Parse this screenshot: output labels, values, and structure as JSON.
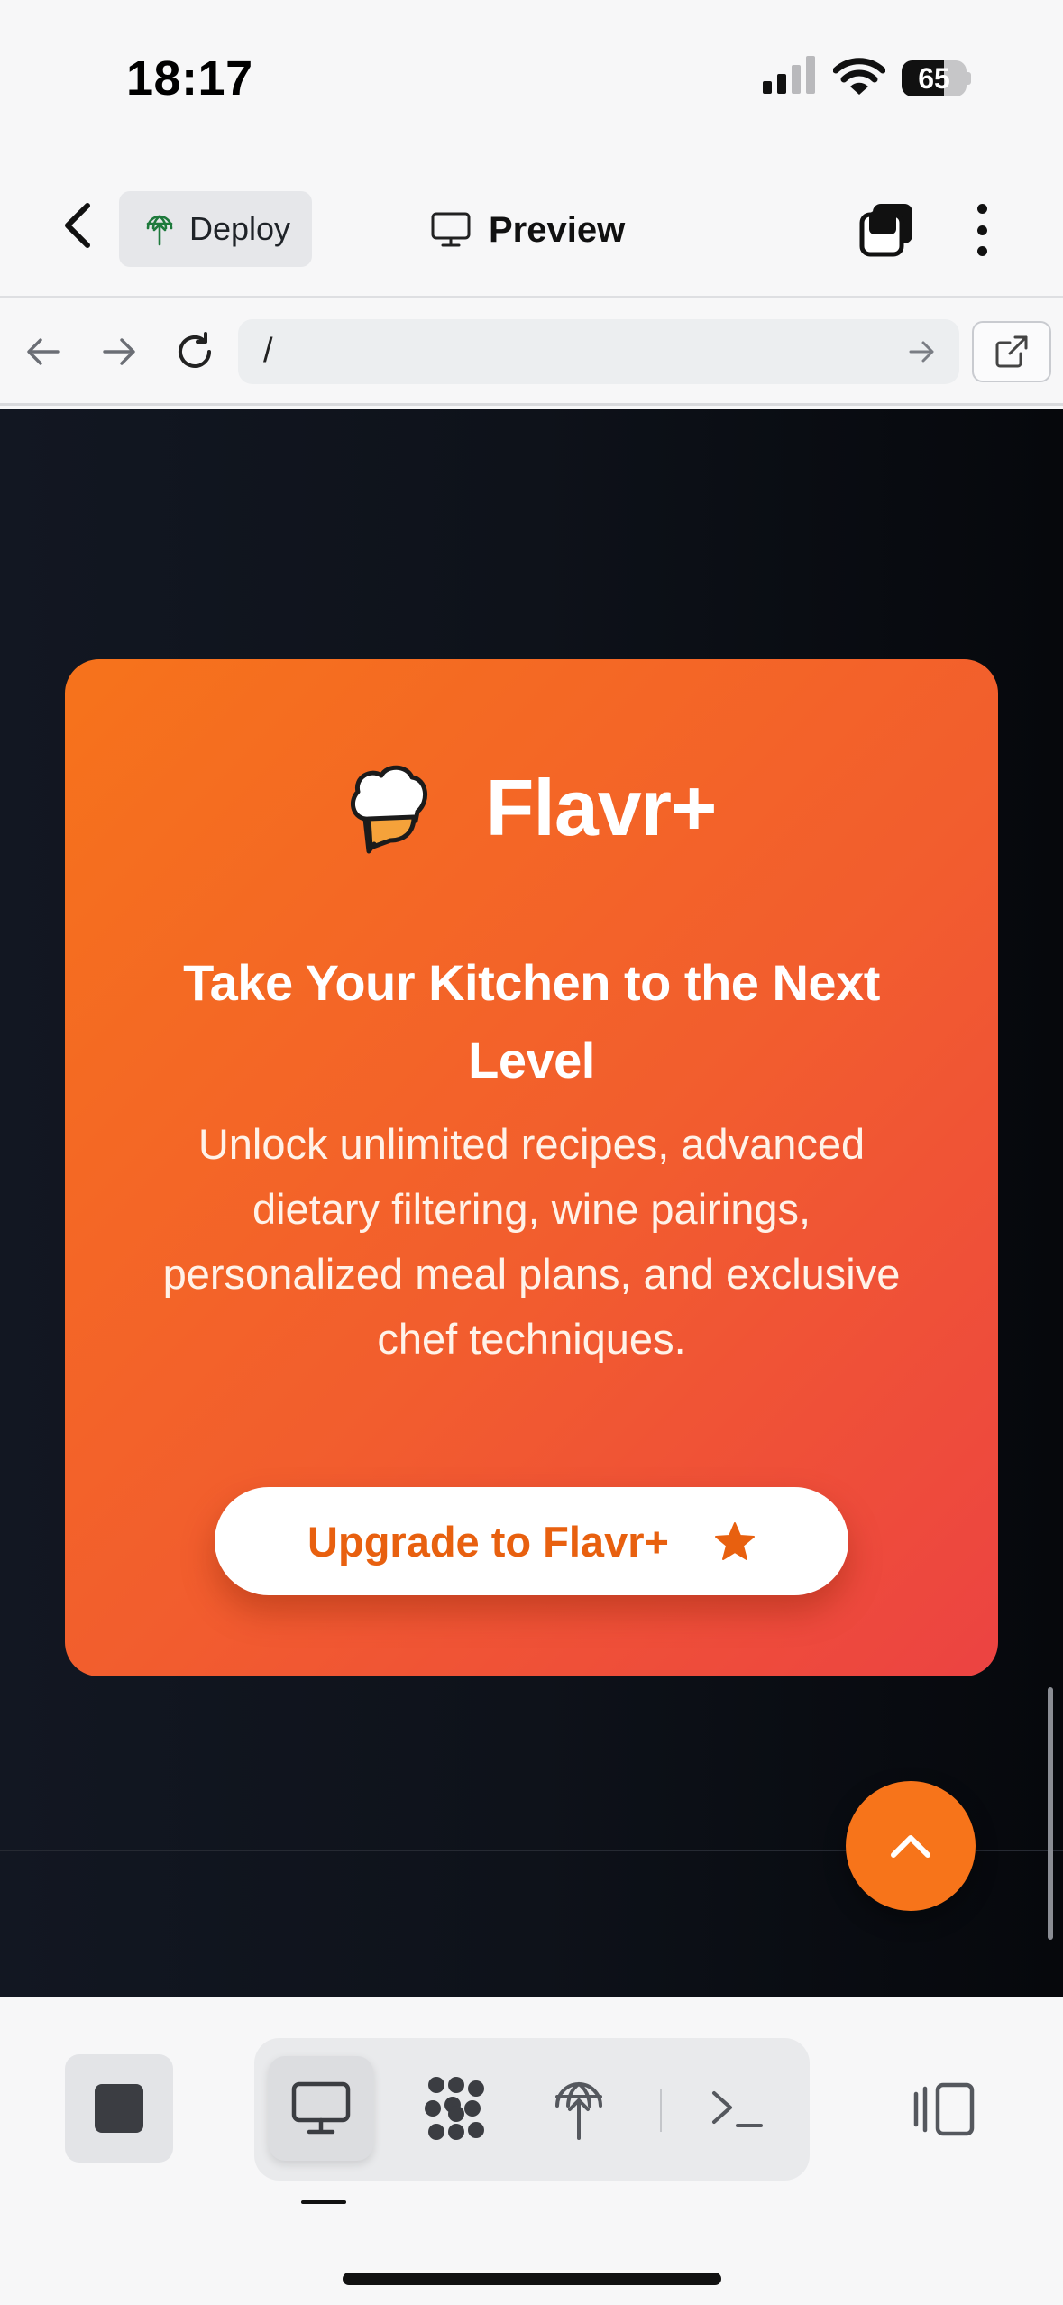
{
  "status_bar": {
    "time": "18:17",
    "battery": "65",
    "battery_level": 0.65
  },
  "header": {
    "deploy_label": "Deploy",
    "preview_label": "Preview"
  },
  "url_bar": {
    "path": "/"
  },
  "promo": {
    "brand": "Flavr+",
    "title": "Take Your Kitchen to the Next Level",
    "description": "Unlock unlimited recipes, advanced dietary filtering, wine pairings, personalized meal plans, and exclusive chef techniques.",
    "cta_label": "Upgrade to Flavr+"
  },
  "colors": {
    "card_gradient_start": "#f6731b",
    "card_gradient_end": "#ec4342",
    "cta_text": "#e8600f",
    "scroll_top_button": "#f7741a",
    "viewport_background": "#0e121a"
  },
  "icons": {
    "header": [
      "back-chevron-icon",
      "deploy-globe-icon",
      "monitor-icon",
      "tabs-icon",
      "more-vertical-icon"
    ],
    "url_bar": [
      "arrow-left-icon",
      "arrow-right-icon",
      "reload-icon",
      "go-arrow-icon",
      "external-link-icon"
    ],
    "promo": [
      "chef-hat-icon",
      "star-icon",
      "chevron-up-icon"
    ],
    "toolbar": [
      "stop-icon",
      "monitor-icon",
      "grid-dots-icon",
      "deploy-icon",
      "terminal-icon",
      "layout-panel-icon"
    ]
  }
}
